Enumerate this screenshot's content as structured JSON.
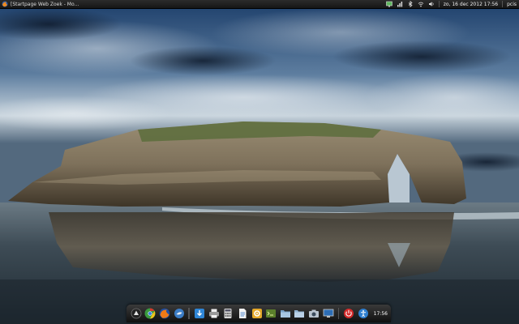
{
  "top_panel": {
    "window_title": "[Startpage Web Zoek - Mo...",
    "tray_icons": [
      "display-icon",
      "network-icon",
      "bluetooth-icon",
      "wifi-icon",
      "volume-icon"
    ],
    "clock": "zo, 16 dec 2012 17:56",
    "user": "pcis"
  },
  "dock": {
    "items": [
      "start-icon",
      "chrome-icon",
      "firefox-icon",
      "mail-icon",
      "download-icon",
      "printer-icon",
      "calculator-icon",
      "document-icon",
      "settings-icon",
      "terminal-icon",
      "files-icon",
      "folder-icon",
      "camera-icon",
      "monitor-icon",
      "power-icon",
      "accessibility-icon"
    ],
    "clock": "17:56"
  },
  "colors": {
    "panel": "#1e1e1e",
    "dock": "#1a1a1a",
    "sky": "#2f5d93",
    "rock": "#8a7d66",
    "sea": "#3c4d58"
  }
}
